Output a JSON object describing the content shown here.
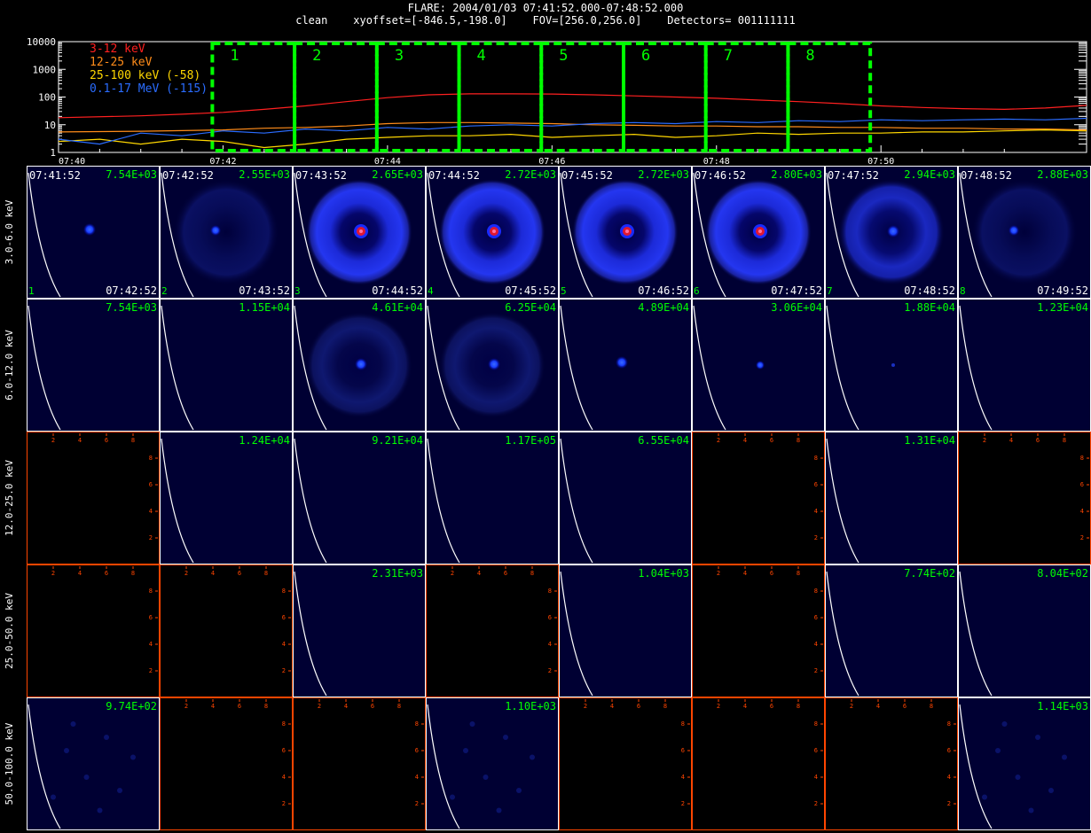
{
  "header": {
    "title": "FLARE: 2004/01/03 07:41:52.000-07:48:52.000",
    "subtitle": "clean    xyoffset=[-846.5,-198.0]    FOV=[256.0,256.0]    Detectors= 001111111"
  },
  "colors": {
    "green": "#00ff00",
    "red": "#ff2020",
    "orange": "#ff8c1a",
    "yellow": "#ffd700",
    "blue": "#2a6cff",
    "panel_bg": "#000033",
    "axis_orange": "#ff4500"
  },
  "chart_data": [
    {
      "type": "line",
      "title": "",
      "ylim": [
        1,
        10000
      ],
      "yscale": "log",
      "y_tick_labels": [
        "10000",
        "1000",
        "100",
        "10",
        "1"
      ],
      "x_range_minutes": [
        0,
        12.5
      ],
      "x_tick_labels": [
        "07:40",
        "07:42",
        "07:44",
        "07:46",
        "07:48",
        "07:50"
      ],
      "legend": [
        "3-12 keV",
        "12-25 keV",
        "25-100 keV (-58)",
        "0.1-17 MeV (-115)"
      ],
      "legend_placement": "top-left",
      "series": [
        {
          "name": "3-12 keV",
          "color": "#ff2020",
          "x": [
            0,
            1,
            1.5,
            2,
            2.5,
            3,
            3.5,
            4,
            4.5,
            5,
            5.5,
            6,
            6.5,
            7,
            7.5,
            8,
            8.5,
            9,
            9.5,
            10,
            10.5,
            11,
            11.5,
            12,
            12.5
          ],
          "y": [
            18,
            21,
            24,
            28,
            36,
            48,
            68,
            95,
            120,
            130,
            130,
            128,
            120,
            110,
            100,
            90,
            78,
            68,
            58,
            48,
            42,
            38,
            36,
            40,
            50
          ]
        },
        {
          "name": "12-25 keV",
          "color": "#ff8c1a",
          "x": [
            0,
            1,
            2,
            2.5,
            3,
            3.5,
            4,
            4.5,
            5,
            5.5,
            6,
            6.5,
            7,
            7.5,
            8,
            8.5,
            9,
            9.5,
            10,
            10.5,
            11,
            11.5,
            12,
            12.5
          ],
          "y": [
            5.5,
            5.8,
            6.5,
            7.5,
            8,
            9,
            11,
            12,
            12,
            11.5,
            11,
            10,
            9.5,
            9,
            9,
            8.5,
            8.5,
            8,
            8,
            7.5,
            7.5,
            7,
            7,
            6.5
          ]
        },
        {
          "name": "25-100 keV (-58)",
          "color": "#ffd700",
          "x": [
            0,
            0.5,
            1,
            1.5,
            2,
            2.5,
            3,
            3.5,
            4,
            4.5,
            5,
            5.5,
            6,
            6.5,
            7,
            7.5,
            8,
            8.5,
            9,
            9.5,
            10,
            10.5,
            11,
            11.5,
            12,
            12.5
          ],
          "y": [
            2.5,
            3,
            2,
            3,
            2.5,
            1.5,
            2,
            3,
            3.5,
            4,
            4,
            4.5,
            3.5,
            4,
            4.5,
            3.5,
            4,
            5,
            4.5,
            5,
            5,
            5.5,
            5.5,
            6,
            6.5,
            6
          ]
        },
        {
          "name": "0.1-17 MeV (-115)",
          "color": "#2a6cff",
          "x": [
            0,
            0.5,
            1,
            1.5,
            2,
            2.5,
            3,
            3.5,
            4,
            4.5,
            5,
            5.5,
            6,
            6.5,
            7,
            7.5,
            8,
            8.5,
            9,
            9.5,
            10,
            10.5,
            11,
            11.5,
            12,
            12.5
          ],
          "y": [
            3,
            2,
            5,
            4,
            6,
            5,
            7,
            6,
            8,
            7,
            9,
            10,
            9,
            11,
            12,
            11,
            13,
            12,
            14,
            13,
            15,
            14,
            15,
            16,
            15,
            17
          ]
        }
      ],
      "annotations": {
        "intervals": [
          "1",
          "2",
          "3",
          "4",
          "5",
          "6",
          "7",
          "8"
        ],
        "interval_color": "#00ff00"
      }
    },
    {
      "type": "heatmap",
      "title": "",
      "row_labels": [
        "3.0-6.0 keV",
        "6.0-12.0 keV",
        "12.0-25.0 keV",
        "25.0-50.0 keV",
        "50.0-100.0 keV"
      ],
      "start_times": [
        "07:41:52",
        "07:42:52",
        "07:43:52",
        "07:44:52",
        "07:45:52",
        "07:46:52",
        "07:47:52",
        "07:48:52"
      ],
      "end_times": [
        "07:42:52",
        "07:43:52",
        "07:44:52",
        "07:45:52",
        "07:46:52",
        "07:47:52",
        "07:48:52",
        "07:49:52"
      ],
      "panel_numbers": [
        "1",
        "2",
        "3",
        "4",
        "5",
        "6",
        "7",
        "8"
      ],
      "axis_ticks": [
        "2",
        "4",
        "6",
        "8"
      ],
      "rows": [
        {
          "peaks": [
            "7.54E+03",
            "2.55E+03",
            "2.65E+03",
            "2.72E+03",
            "2.72E+03",
            "2.80E+03",
            "2.94E+03",
            "2.88E+03"
          ],
          "images": [
            "dot",
            "faint_ring",
            "ring_red",
            "ring_red",
            "ring_red",
            "ring_red",
            "ring",
            "faint_ring"
          ]
        },
        {
          "peaks": [
            "7.54E+03",
            "1.15E+04",
            "4.61E+04",
            "6.25E+04",
            "4.89E+04",
            "3.06E+04",
            "1.88E+04",
            "1.23E+04"
          ],
          "images": [
            "none",
            "none",
            "ring_dim",
            "ring_dim",
            "dot",
            "small_dot",
            "tiny_dot",
            "none"
          ]
        },
        {
          "peaks": [
            "",
            "1.24E+04",
            "9.21E+04",
            "1.17E+05",
            "6.55E+04",
            "",
            "1.31E+04",
            ""
          ],
          "images": [
            "blank",
            "none",
            "none",
            "none",
            "none",
            "blank",
            "none",
            "blank"
          ]
        },
        {
          "peaks": [
            "",
            "",
            "2.31E+03",
            "",
            "1.04E+03",
            "",
            "7.74E+02",
            "8.04E+02"
          ],
          "images": [
            "blank",
            "blank",
            "none",
            "blank",
            "none",
            "blank",
            "none",
            "none"
          ]
        },
        {
          "peaks": [
            "9.74E+02",
            "",
            "",
            "1.10E+03",
            "",
            "",
            "",
            "1.14E+03"
          ],
          "images": [
            "speckle",
            "blank",
            "blank",
            "speckle",
            "blank",
            "blank",
            "blank",
            "speckle"
          ]
        }
      ]
    }
  ]
}
